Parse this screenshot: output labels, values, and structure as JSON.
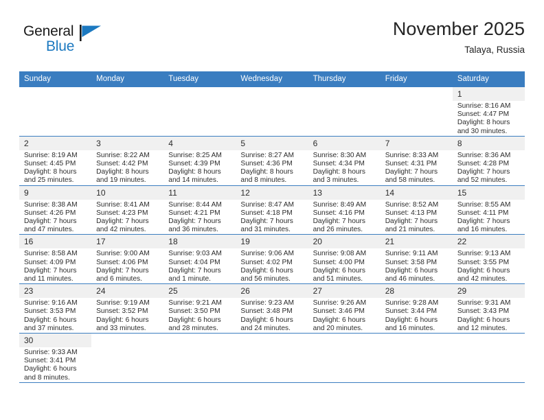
{
  "brand": {
    "name_part1": "General",
    "name_part2": "Blue",
    "flag_icon": "flag-triangle-icon",
    "accent_color": "#1c79c0"
  },
  "header": {
    "title": "November 2025",
    "location": "Talaya, Russia"
  },
  "theme": {
    "header_blue": "#3a7dc0",
    "daynum_bg": "#f0f0f0",
    "text": "#2b2b2b"
  },
  "calendar": {
    "weekday_headers": [
      "Sunday",
      "Monday",
      "Tuesday",
      "Wednesday",
      "Thursday",
      "Friday",
      "Saturday"
    ],
    "weeks": [
      [
        {
          "blank": true
        },
        {
          "blank": true
        },
        {
          "blank": true
        },
        {
          "blank": true
        },
        {
          "blank": true
        },
        {
          "blank": true
        },
        {
          "day": "1",
          "sunrise": "Sunrise: 8:16 AM",
          "sunset": "Sunset: 4:47 PM",
          "daylight1": "Daylight: 8 hours",
          "daylight2": "and 30 minutes."
        }
      ],
      [
        {
          "day": "2",
          "sunrise": "Sunrise: 8:19 AM",
          "sunset": "Sunset: 4:45 PM",
          "daylight1": "Daylight: 8 hours",
          "daylight2": "and 25 minutes."
        },
        {
          "day": "3",
          "sunrise": "Sunrise: 8:22 AM",
          "sunset": "Sunset: 4:42 PM",
          "daylight1": "Daylight: 8 hours",
          "daylight2": "and 19 minutes."
        },
        {
          "day": "4",
          "sunrise": "Sunrise: 8:25 AM",
          "sunset": "Sunset: 4:39 PM",
          "daylight1": "Daylight: 8 hours",
          "daylight2": "and 14 minutes."
        },
        {
          "day": "5",
          "sunrise": "Sunrise: 8:27 AM",
          "sunset": "Sunset: 4:36 PM",
          "daylight1": "Daylight: 8 hours",
          "daylight2": "and 8 minutes."
        },
        {
          "day": "6",
          "sunrise": "Sunrise: 8:30 AM",
          "sunset": "Sunset: 4:34 PM",
          "daylight1": "Daylight: 8 hours",
          "daylight2": "and 3 minutes."
        },
        {
          "day": "7",
          "sunrise": "Sunrise: 8:33 AM",
          "sunset": "Sunset: 4:31 PM",
          "daylight1": "Daylight: 7 hours",
          "daylight2": "and 58 minutes."
        },
        {
          "day": "8",
          "sunrise": "Sunrise: 8:36 AM",
          "sunset": "Sunset: 4:28 PM",
          "daylight1": "Daylight: 7 hours",
          "daylight2": "and 52 minutes."
        }
      ],
      [
        {
          "day": "9",
          "sunrise": "Sunrise: 8:38 AM",
          "sunset": "Sunset: 4:26 PM",
          "daylight1": "Daylight: 7 hours",
          "daylight2": "and 47 minutes."
        },
        {
          "day": "10",
          "sunrise": "Sunrise: 8:41 AM",
          "sunset": "Sunset: 4:23 PM",
          "daylight1": "Daylight: 7 hours",
          "daylight2": "and 42 minutes."
        },
        {
          "day": "11",
          "sunrise": "Sunrise: 8:44 AM",
          "sunset": "Sunset: 4:21 PM",
          "daylight1": "Daylight: 7 hours",
          "daylight2": "and 36 minutes."
        },
        {
          "day": "12",
          "sunrise": "Sunrise: 8:47 AM",
          "sunset": "Sunset: 4:18 PM",
          "daylight1": "Daylight: 7 hours",
          "daylight2": "and 31 minutes."
        },
        {
          "day": "13",
          "sunrise": "Sunrise: 8:49 AM",
          "sunset": "Sunset: 4:16 PM",
          "daylight1": "Daylight: 7 hours",
          "daylight2": "and 26 minutes."
        },
        {
          "day": "14",
          "sunrise": "Sunrise: 8:52 AM",
          "sunset": "Sunset: 4:13 PM",
          "daylight1": "Daylight: 7 hours",
          "daylight2": "and 21 minutes."
        },
        {
          "day": "15",
          "sunrise": "Sunrise: 8:55 AM",
          "sunset": "Sunset: 4:11 PM",
          "daylight1": "Daylight: 7 hours",
          "daylight2": "and 16 minutes."
        }
      ],
      [
        {
          "day": "16",
          "sunrise": "Sunrise: 8:58 AM",
          "sunset": "Sunset: 4:09 PM",
          "daylight1": "Daylight: 7 hours",
          "daylight2": "and 11 minutes."
        },
        {
          "day": "17",
          "sunrise": "Sunrise: 9:00 AM",
          "sunset": "Sunset: 4:06 PM",
          "daylight1": "Daylight: 7 hours",
          "daylight2": "and 6 minutes."
        },
        {
          "day": "18",
          "sunrise": "Sunrise: 9:03 AM",
          "sunset": "Sunset: 4:04 PM",
          "daylight1": "Daylight: 7 hours",
          "daylight2": "and 1 minute."
        },
        {
          "day": "19",
          "sunrise": "Sunrise: 9:06 AM",
          "sunset": "Sunset: 4:02 PM",
          "daylight1": "Daylight: 6 hours",
          "daylight2": "and 56 minutes."
        },
        {
          "day": "20",
          "sunrise": "Sunrise: 9:08 AM",
          "sunset": "Sunset: 4:00 PM",
          "daylight1": "Daylight: 6 hours",
          "daylight2": "and 51 minutes."
        },
        {
          "day": "21",
          "sunrise": "Sunrise: 9:11 AM",
          "sunset": "Sunset: 3:58 PM",
          "daylight1": "Daylight: 6 hours",
          "daylight2": "and 46 minutes."
        },
        {
          "day": "22",
          "sunrise": "Sunrise: 9:13 AM",
          "sunset": "Sunset: 3:55 PM",
          "daylight1": "Daylight: 6 hours",
          "daylight2": "and 42 minutes."
        }
      ],
      [
        {
          "day": "23",
          "sunrise": "Sunrise: 9:16 AM",
          "sunset": "Sunset: 3:53 PM",
          "daylight1": "Daylight: 6 hours",
          "daylight2": "and 37 minutes."
        },
        {
          "day": "24",
          "sunrise": "Sunrise: 9:19 AM",
          "sunset": "Sunset: 3:52 PM",
          "daylight1": "Daylight: 6 hours",
          "daylight2": "and 33 minutes."
        },
        {
          "day": "25",
          "sunrise": "Sunrise: 9:21 AM",
          "sunset": "Sunset: 3:50 PM",
          "daylight1": "Daylight: 6 hours",
          "daylight2": "and 28 minutes."
        },
        {
          "day": "26",
          "sunrise": "Sunrise: 9:23 AM",
          "sunset": "Sunset: 3:48 PM",
          "daylight1": "Daylight: 6 hours",
          "daylight2": "and 24 minutes."
        },
        {
          "day": "27",
          "sunrise": "Sunrise: 9:26 AM",
          "sunset": "Sunset: 3:46 PM",
          "daylight1": "Daylight: 6 hours",
          "daylight2": "and 20 minutes."
        },
        {
          "day": "28",
          "sunrise": "Sunrise: 9:28 AM",
          "sunset": "Sunset: 3:44 PM",
          "daylight1": "Daylight: 6 hours",
          "daylight2": "and 16 minutes."
        },
        {
          "day": "29",
          "sunrise": "Sunrise: 9:31 AM",
          "sunset": "Sunset: 3:43 PM",
          "daylight1": "Daylight: 6 hours",
          "daylight2": "and 12 minutes."
        }
      ],
      [
        {
          "day": "30",
          "sunrise": "Sunrise: 9:33 AM",
          "sunset": "Sunset: 3:41 PM",
          "daylight1": "Daylight: 6 hours",
          "daylight2": "and 8 minutes."
        },
        {
          "blank": true
        },
        {
          "blank": true
        },
        {
          "blank": true
        },
        {
          "blank": true
        },
        {
          "blank": true
        },
        {
          "blank": true
        }
      ]
    ]
  }
}
